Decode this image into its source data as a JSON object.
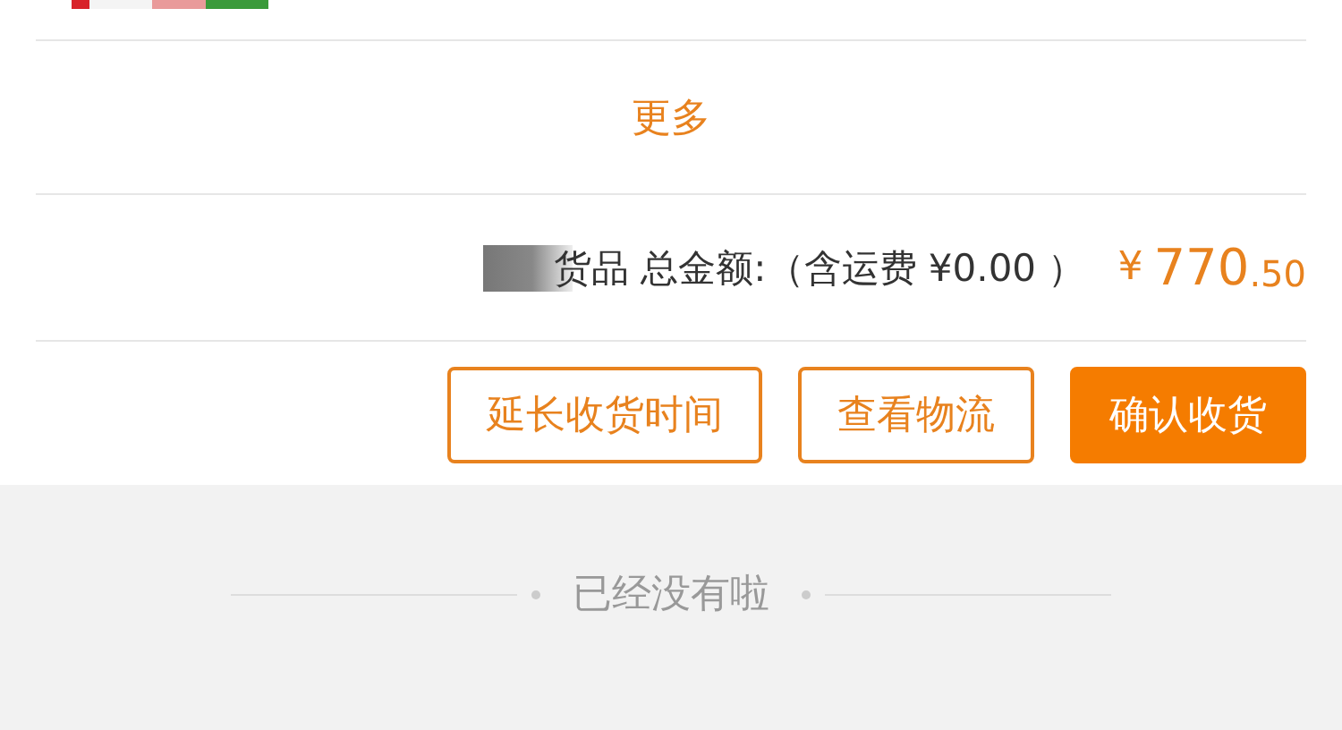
{
  "more_link": "更多",
  "total": {
    "label": "货品 总金额:（含运费 ¥0.00 ）",
    "currency": "¥",
    "price_integer": "770",
    "price_decimal": ".50"
  },
  "buttons": [
    {
      "label": "延长收货时间",
      "kind": "outline"
    },
    {
      "label": "查看物流",
      "kind": "outline"
    },
    {
      "label": "确认收货",
      "kind": "primary"
    }
  ],
  "end_notice": "已经没有啦"
}
